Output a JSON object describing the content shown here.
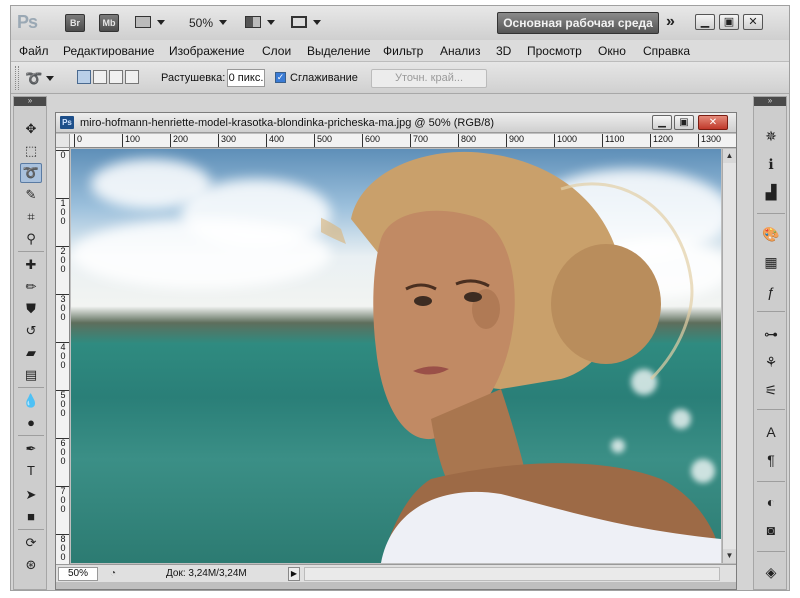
{
  "app": {
    "logo": "Ps",
    "bridge_label": "Br",
    "minibridge_label": "Mb",
    "zoom_level": "50%",
    "workspace_label": "Основная рабочая среда",
    "more_label": "»"
  },
  "menu": [
    "Файл",
    "Редактирование",
    "Изображение",
    "Слои",
    "Выделение",
    "Фильтр",
    "Анализ",
    "3D",
    "Просмотр",
    "Окно",
    "Справка"
  ],
  "options": {
    "feather_label": "Растушевка:",
    "feather_value": "0 пикс.",
    "antialias_label": "Сглаживание",
    "antialias_checked": true,
    "refine_edge_label": "Уточн. край..."
  },
  "document": {
    "title": "miro-hofmann-henriette-model-krasotka-blondinka-pricheska-ma.jpg @ 50% (RGB/8)",
    "ps_badge": "Ps",
    "ruler_h": [
      "0",
      "100",
      "200",
      "300",
      "400",
      "500",
      "600",
      "700",
      "800",
      "900",
      "1000",
      "1100",
      "1200",
      "1300"
    ],
    "ruler_v": [
      "0",
      "1 0 0",
      "2 0 0",
      "3 0 0",
      "4 0 0",
      "5 0 0",
      "6 0 0",
      "7 0 0",
      "8 0 0"
    ],
    "status_zoom": "50%",
    "status_doc": "Док: 3,24M/3,24M"
  },
  "colors": {
    "accent": "#a9c1dd",
    "close_red": "#c0392b",
    "toolbar_bg": "#cdcdcd"
  },
  "tools": [
    {
      "icon": "move-icon",
      "glyph": "✥"
    },
    {
      "icon": "marquee-icon",
      "glyph": "⬚"
    },
    {
      "icon": "lasso-icon",
      "glyph": "➰",
      "active": true
    },
    {
      "icon": "quick-select-icon",
      "glyph": "✎"
    },
    {
      "icon": "crop-icon",
      "glyph": "⌗"
    },
    {
      "icon": "eyedropper-icon",
      "glyph": "⚲"
    },
    {
      "icon": "healing-brush-icon",
      "glyph": "✚"
    },
    {
      "icon": "brush-icon",
      "glyph": "✏"
    },
    {
      "icon": "clone-stamp-icon",
      "glyph": "⛊"
    },
    {
      "icon": "history-brush-icon",
      "glyph": "↺"
    },
    {
      "icon": "eraser-icon",
      "glyph": "▰"
    },
    {
      "icon": "gradient-icon",
      "glyph": "▤"
    },
    {
      "icon": "blur-icon",
      "glyph": "💧"
    },
    {
      "icon": "dodge-icon",
      "glyph": "●"
    },
    {
      "icon": "pen-icon",
      "glyph": "✒"
    },
    {
      "icon": "type-icon",
      "glyph": "T"
    },
    {
      "icon": "path-select-icon",
      "glyph": "➤"
    },
    {
      "icon": "shape-icon",
      "glyph": "■"
    },
    {
      "icon": "3d-rotate-icon",
      "glyph": "⟳"
    },
    {
      "icon": "3d-orbit-icon",
      "glyph": "⊛"
    }
  ],
  "panels": [
    {
      "icon": "navigator-icon",
      "glyph": "✵"
    },
    {
      "icon": "info-icon",
      "glyph": "ℹ"
    },
    {
      "icon": "histogram-icon",
      "glyph": "▟"
    },
    {
      "icon": "color-palette-icon",
      "glyph": "🎨"
    },
    {
      "icon": "swatches-icon",
      "glyph": "▦"
    },
    {
      "icon": "styles-fx-icon",
      "glyph": "ƒ"
    },
    {
      "icon": "adjustments-icon",
      "glyph": "⊶"
    },
    {
      "icon": "brushes-icon",
      "glyph": "⚘"
    },
    {
      "icon": "clone-source-icon",
      "glyph": "⚟"
    },
    {
      "icon": "character-icon",
      "glyph": "A"
    },
    {
      "icon": "paragraph-icon",
      "glyph": "¶"
    },
    {
      "icon": "masks-icon",
      "glyph": "◐"
    },
    {
      "icon": "channels-icon",
      "glyph": "◙"
    },
    {
      "icon": "layers-icon",
      "glyph": "◈"
    }
  ]
}
